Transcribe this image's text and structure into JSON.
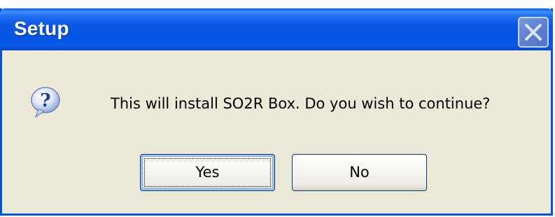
{
  "window": {
    "title": "Setup"
  },
  "dialog": {
    "icon": "question-icon",
    "message": "This will install SO2R Box. Do you wish to continue?"
  },
  "buttons": {
    "yes_label": "Yes",
    "no_label": "No"
  },
  "colors": {
    "titlebar": "#0054e3",
    "dialog_background": "#ece9d8",
    "button_border": "#003c74"
  }
}
